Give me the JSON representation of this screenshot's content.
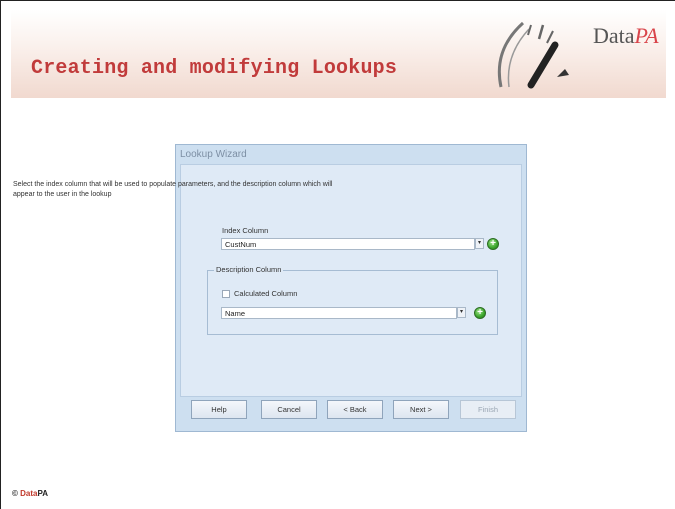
{
  "slide": {
    "title": "Creating and modifying Lookups",
    "logo_prefix": "Data",
    "logo_suffix": "PA",
    "footer_symbol": "©",
    "footer_data": "Data",
    "footer_pa": "PA"
  },
  "wizard": {
    "title": "Lookup Wizard",
    "instruction": "Select the index column that will be used to populate parameters, and the description column which will appear to the user in the lookup",
    "index_column_label": "Index Column",
    "index_column_value": "CustNum",
    "description_group_label": "Description Column",
    "calculated_column_label": "Calculated Column",
    "calculated_column_checked": false,
    "description_value": "Name",
    "buttons": {
      "help": "Help",
      "cancel": "Cancel",
      "back": "< Back",
      "next": "Next >",
      "finish": "Finish"
    }
  },
  "icons": {
    "dropdown": "chevron-down-icon",
    "add": "green-add-icon"
  },
  "colors": {
    "title_red": "#c13b3b",
    "wizard_bg": "#cddff0",
    "add_green": "#3aa52b"
  }
}
